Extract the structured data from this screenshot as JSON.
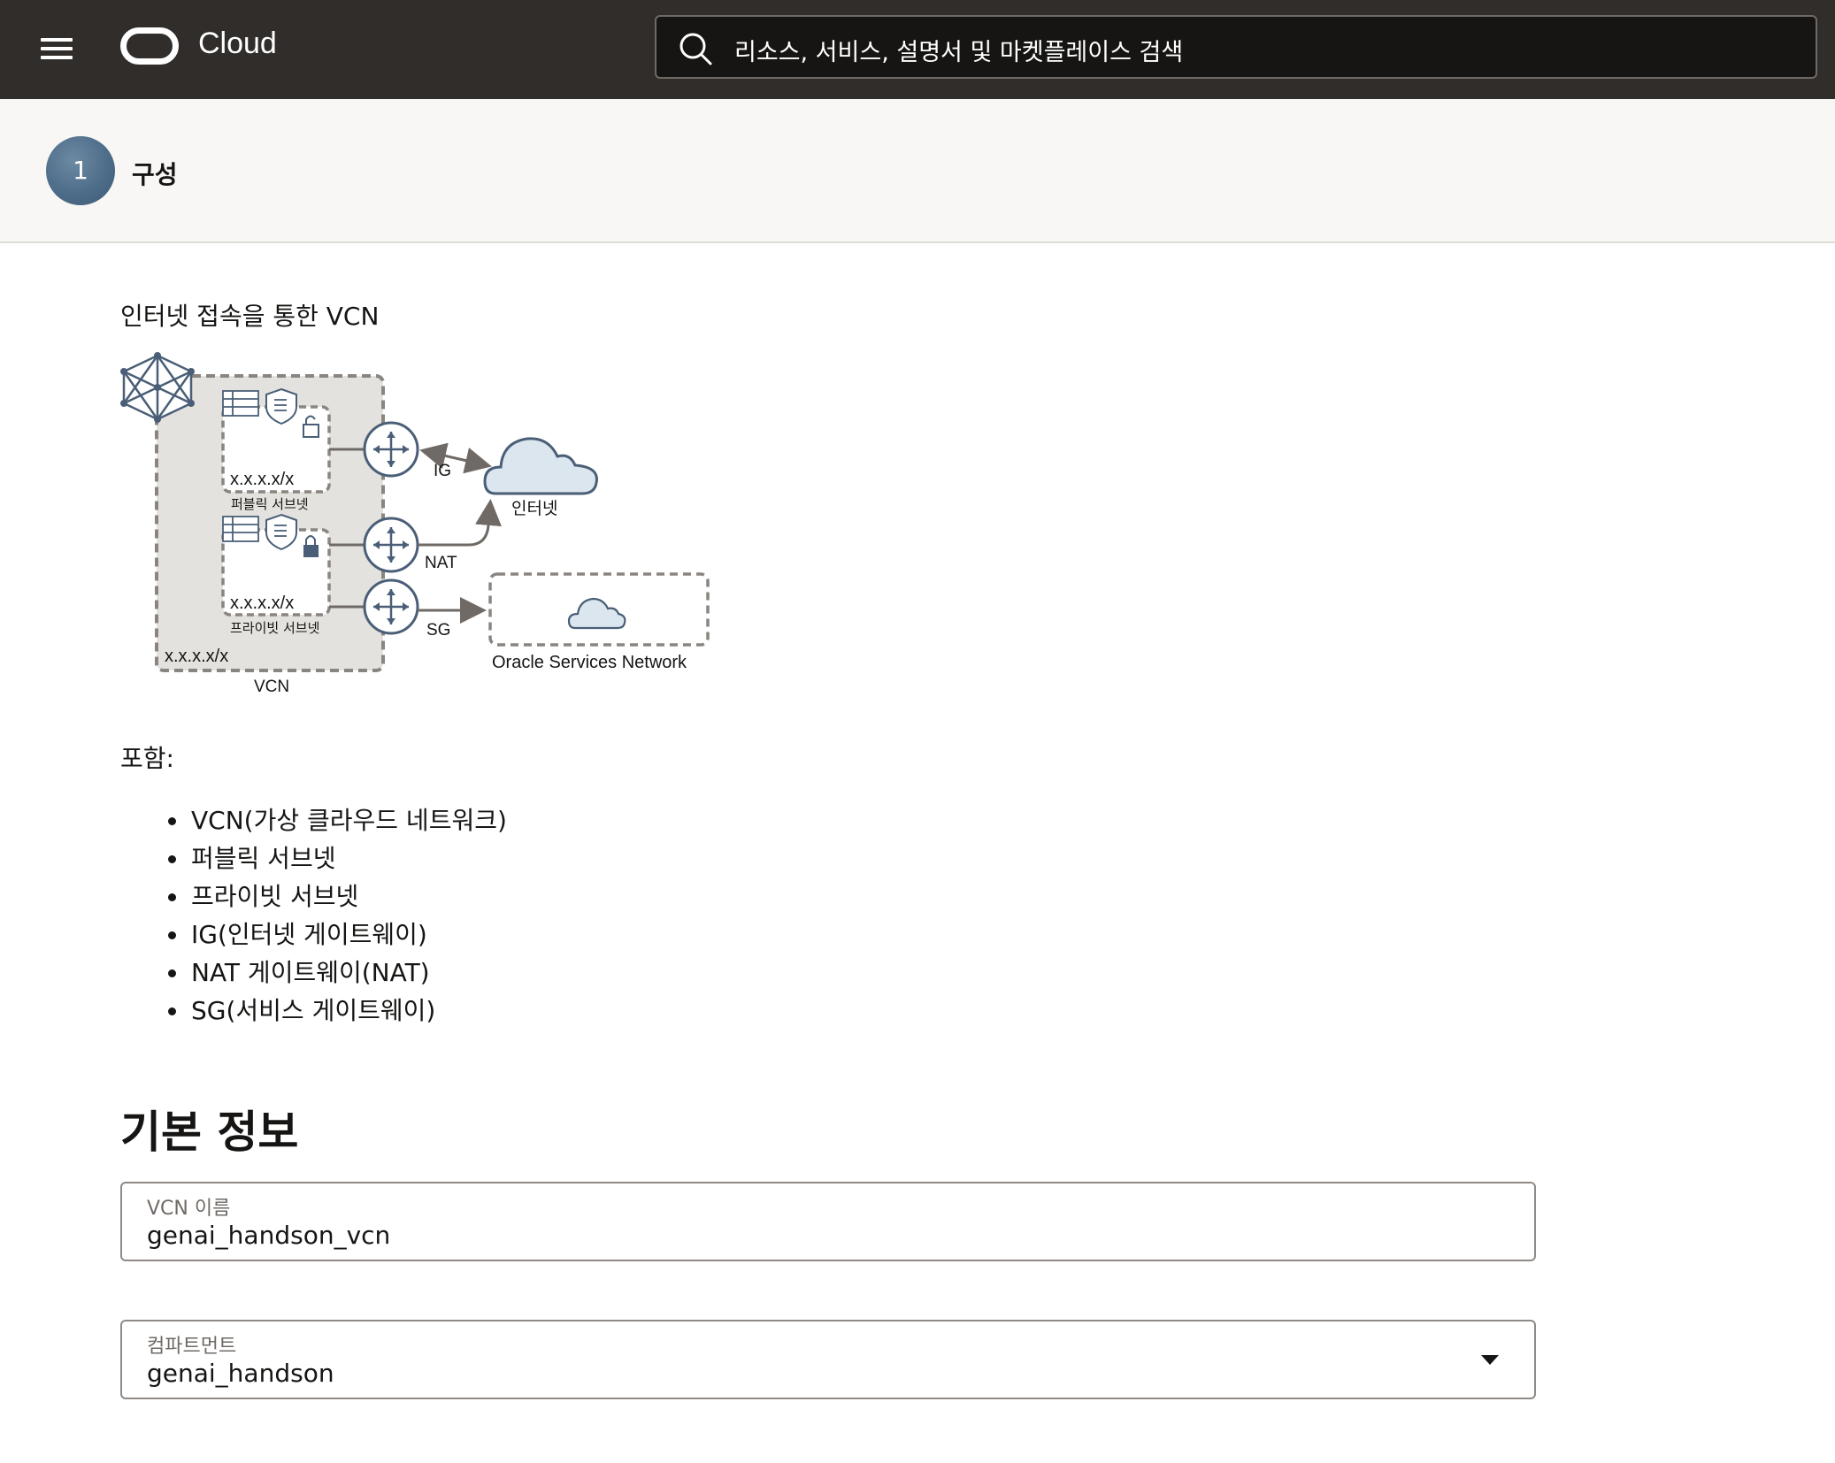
{
  "header": {
    "brand": "Cloud",
    "search_placeholder": "리소스, 서비스, 설명서 및 마켓플레이스 검색"
  },
  "step": {
    "number": "1",
    "label": "구성"
  },
  "diagram": {
    "title": "인터넷 접속을 통한 VCN",
    "public_subnet_cidr": "x.x.x.x/x",
    "public_subnet_label": "퍼블릭 서브넷",
    "private_subnet_cidr": "x.x.x.x/x",
    "private_subnet_label": "프라이빗 서브넷",
    "vcn_cidr": "x.x.x.x/x",
    "vcn_label": "VCN",
    "ig_label": "IG",
    "nat_label": "NAT",
    "sg_label": "SG",
    "internet_label": "인터넷",
    "osn_label": "Oracle Services Network"
  },
  "includes": {
    "label": "포함:",
    "items": [
      "VCN(가상 클라우드 네트워크)",
      "퍼블릭 서브넷",
      "프라이빗 서브넷",
      "IG(인터넷 게이트웨이)",
      "NAT 게이트웨이(NAT)",
      "SG(서비스 게이트웨이)"
    ]
  },
  "basic_info": {
    "title": "기본 정보",
    "vcn_name_label": "VCN 이름",
    "vcn_name_value": "genai_handson_vcn",
    "compartment_label": "컴파트먼트",
    "compartment_value": "genai_handson"
  },
  "colors": {
    "topbar": "#312d2a",
    "step_circle": "#4e6d89",
    "diagram_fill": "#e4e2de",
    "diagram_stroke": "#8a8580",
    "icon_blue": "#4a5f77",
    "cloud_fill": "#dce6ef"
  }
}
